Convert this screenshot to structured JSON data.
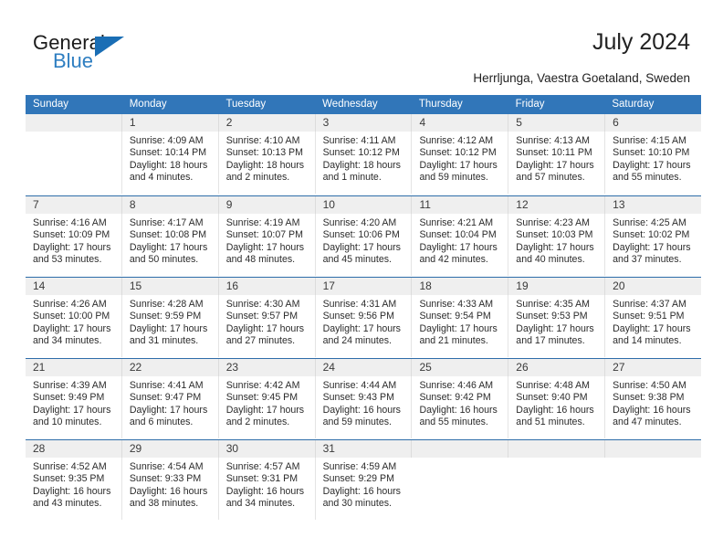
{
  "brand": {
    "name_part1": "General",
    "name_part2": "Blue",
    "accent_color": "#1a6eb5",
    "triangle_icon": "triangle-icon"
  },
  "header": {
    "title": "July 2024",
    "subtitle": "Herrljunga, Vaestra Goetaland, Sweden"
  },
  "calendar": {
    "header_bg": "#3176b9",
    "datestrip_bg": "#efefef",
    "separator_color": "#2e6da9",
    "weekday_headers": [
      "Sunday",
      "Monday",
      "Tuesday",
      "Wednesday",
      "Thursday",
      "Friday",
      "Saturday"
    ],
    "weeks": [
      [
        {
          "day": "",
          "lines": []
        },
        {
          "day": "1",
          "lines": [
            "Sunrise: 4:09 AM",
            "Sunset: 10:14 PM",
            "Daylight: 18 hours",
            "and 4 minutes."
          ]
        },
        {
          "day": "2",
          "lines": [
            "Sunrise: 4:10 AM",
            "Sunset: 10:13 PM",
            "Daylight: 18 hours",
            "and 2 minutes."
          ]
        },
        {
          "day": "3",
          "lines": [
            "Sunrise: 4:11 AM",
            "Sunset: 10:12 PM",
            "Daylight: 18 hours",
            "and 1 minute."
          ]
        },
        {
          "day": "4",
          "lines": [
            "Sunrise: 4:12 AM",
            "Sunset: 10:12 PM",
            "Daylight: 17 hours",
            "and 59 minutes."
          ]
        },
        {
          "day": "5",
          "lines": [
            "Sunrise: 4:13 AM",
            "Sunset: 10:11 PM",
            "Daylight: 17 hours",
            "and 57 minutes."
          ]
        },
        {
          "day": "6",
          "lines": [
            "Sunrise: 4:15 AM",
            "Sunset: 10:10 PM",
            "Daylight: 17 hours",
            "and 55 minutes."
          ]
        }
      ],
      [
        {
          "day": "7",
          "lines": [
            "Sunrise: 4:16 AM",
            "Sunset: 10:09 PM",
            "Daylight: 17 hours",
            "and 53 minutes."
          ]
        },
        {
          "day": "8",
          "lines": [
            "Sunrise: 4:17 AM",
            "Sunset: 10:08 PM",
            "Daylight: 17 hours",
            "and 50 minutes."
          ]
        },
        {
          "day": "9",
          "lines": [
            "Sunrise: 4:19 AM",
            "Sunset: 10:07 PM",
            "Daylight: 17 hours",
            "and 48 minutes."
          ]
        },
        {
          "day": "10",
          "lines": [
            "Sunrise: 4:20 AM",
            "Sunset: 10:06 PM",
            "Daylight: 17 hours",
            "and 45 minutes."
          ]
        },
        {
          "day": "11",
          "lines": [
            "Sunrise: 4:21 AM",
            "Sunset: 10:04 PM",
            "Daylight: 17 hours",
            "and 42 minutes."
          ]
        },
        {
          "day": "12",
          "lines": [
            "Sunrise: 4:23 AM",
            "Sunset: 10:03 PM",
            "Daylight: 17 hours",
            "and 40 minutes."
          ]
        },
        {
          "day": "13",
          "lines": [
            "Sunrise: 4:25 AM",
            "Sunset: 10:02 PM",
            "Daylight: 17 hours",
            "and 37 minutes."
          ]
        }
      ],
      [
        {
          "day": "14",
          "lines": [
            "Sunrise: 4:26 AM",
            "Sunset: 10:00 PM",
            "Daylight: 17 hours",
            "and 34 minutes."
          ]
        },
        {
          "day": "15",
          "lines": [
            "Sunrise: 4:28 AM",
            "Sunset: 9:59 PM",
            "Daylight: 17 hours",
            "and 31 minutes."
          ]
        },
        {
          "day": "16",
          "lines": [
            "Sunrise: 4:30 AM",
            "Sunset: 9:57 PM",
            "Daylight: 17 hours",
            "and 27 minutes."
          ]
        },
        {
          "day": "17",
          "lines": [
            "Sunrise: 4:31 AM",
            "Sunset: 9:56 PM",
            "Daylight: 17 hours",
            "and 24 minutes."
          ]
        },
        {
          "day": "18",
          "lines": [
            "Sunrise: 4:33 AM",
            "Sunset: 9:54 PM",
            "Daylight: 17 hours",
            "and 21 minutes."
          ]
        },
        {
          "day": "19",
          "lines": [
            "Sunrise: 4:35 AM",
            "Sunset: 9:53 PM",
            "Daylight: 17 hours",
            "and 17 minutes."
          ]
        },
        {
          "day": "20",
          "lines": [
            "Sunrise: 4:37 AM",
            "Sunset: 9:51 PM",
            "Daylight: 17 hours",
            "and 14 minutes."
          ]
        }
      ],
      [
        {
          "day": "21",
          "lines": [
            "Sunrise: 4:39 AM",
            "Sunset: 9:49 PM",
            "Daylight: 17 hours",
            "and 10 minutes."
          ]
        },
        {
          "day": "22",
          "lines": [
            "Sunrise: 4:41 AM",
            "Sunset: 9:47 PM",
            "Daylight: 17 hours",
            "and 6 minutes."
          ]
        },
        {
          "day": "23",
          "lines": [
            "Sunrise: 4:42 AM",
            "Sunset: 9:45 PM",
            "Daylight: 17 hours",
            "and 2 minutes."
          ]
        },
        {
          "day": "24",
          "lines": [
            "Sunrise: 4:44 AM",
            "Sunset: 9:43 PM",
            "Daylight: 16 hours",
            "and 59 minutes."
          ]
        },
        {
          "day": "25",
          "lines": [
            "Sunrise: 4:46 AM",
            "Sunset: 9:42 PM",
            "Daylight: 16 hours",
            "and 55 minutes."
          ]
        },
        {
          "day": "26",
          "lines": [
            "Sunrise: 4:48 AM",
            "Sunset: 9:40 PM",
            "Daylight: 16 hours",
            "and 51 minutes."
          ]
        },
        {
          "day": "27",
          "lines": [
            "Sunrise: 4:50 AM",
            "Sunset: 9:38 PM",
            "Daylight: 16 hours",
            "and 47 minutes."
          ]
        }
      ],
      [
        {
          "day": "28",
          "lines": [
            "Sunrise: 4:52 AM",
            "Sunset: 9:35 PM",
            "Daylight: 16 hours",
            "and 43 minutes."
          ]
        },
        {
          "day": "29",
          "lines": [
            "Sunrise: 4:54 AM",
            "Sunset: 9:33 PM",
            "Daylight: 16 hours",
            "and 38 minutes."
          ]
        },
        {
          "day": "30",
          "lines": [
            "Sunrise: 4:57 AM",
            "Sunset: 9:31 PM",
            "Daylight: 16 hours",
            "and 34 minutes."
          ]
        },
        {
          "day": "31",
          "lines": [
            "Sunrise: 4:59 AM",
            "Sunset: 9:29 PM",
            "Daylight: 16 hours",
            "and 30 minutes."
          ]
        },
        {
          "day": "",
          "lines": []
        },
        {
          "day": "",
          "lines": []
        },
        {
          "day": "",
          "lines": []
        }
      ]
    ]
  }
}
